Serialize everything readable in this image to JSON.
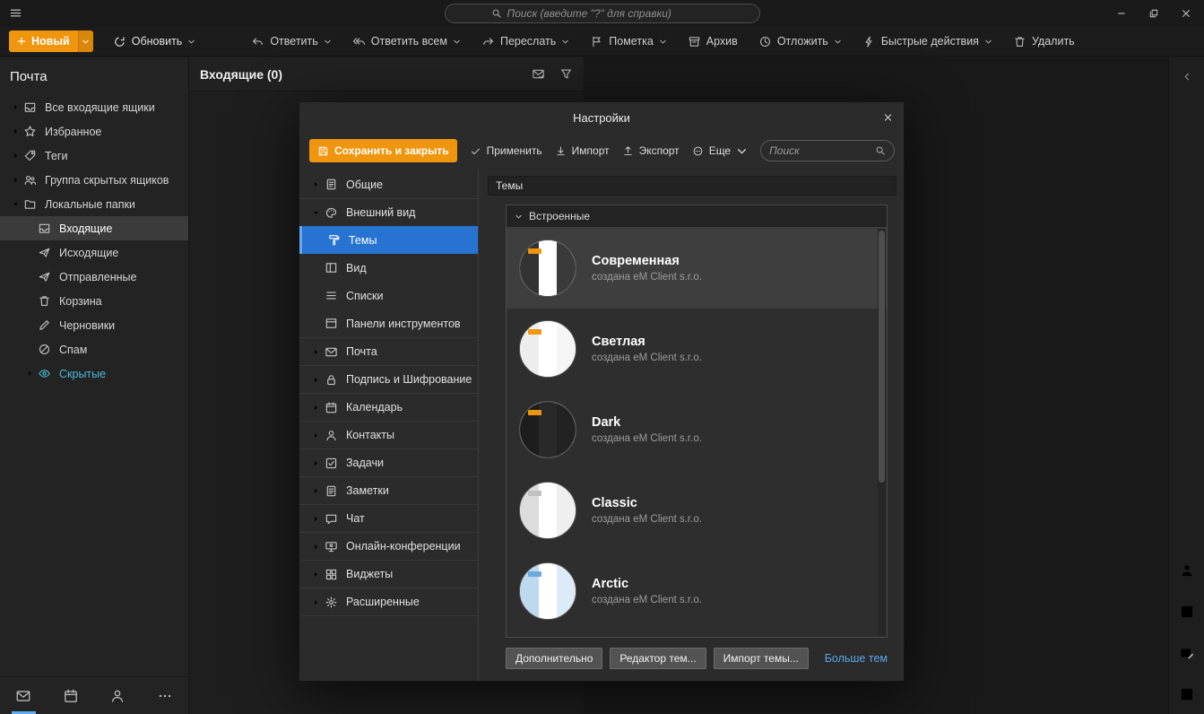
{
  "colors": {
    "accent_orange": "#f0960e",
    "selection_blue": "#2673d2",
    "link_blue": "#58a8ea",
    "hidden_teal": "#49bcd8"
  },
  "titlebar": {
    "search_placeholder": "Поиск (введите \"?\" для справки)"
  },
  "toolbar": {
    "new": {
      "label": "Новый"
    },
    "refresh": {
      "label": "Обновить"
    },
    "buttons": [
      {
        "id": "reply",
        "label": "Ответить",
        "icon": "reply-icon",
        "dropdown": true
      },
      {
        "id": "reply-all",
        "label": "Ответить всем",
        "icon": "reply-all-icon",
        "dropdown": true
      },
      {
        "id": "forward",
        "label": "Переслать",
        "icon": "forward-icon",
        "dropdown": true
      },
      {
        "id": "flag",
        "label": "Пометка",
        "icon": "flag-icon",
        "dropdown": true
      },
      {
        "id": "archive",
        "label": "Архив",
        "icon": "archive-icon",
        "dropdown": false
      },
      {
        "id": "snooze",
        "label": "Отложить",
        "icon": "snooze-icon",
        "dropdown": true
      },
      {
        "id": "quick-actions",
        "label": "Быстрые действия",
        "icon": "quick-actions-icon",
        "dropdown": true
      },
      {
        "id": "delete",
        "label": "Удалить",
        "icon": "delete-icon",
        "dropdown": false
      }
    ]
  },
  "sidebar": {
    "title": "Почта",
    "items": [
      {
        "id": "all-inboxes",
        "label": "Все входящие ящики",
        "icon": "inbox-all-icon",
        "chevron": "right",
        "level": 0
      },
      {
        "id": "favorites",
        "label": "Избранное",
        "icon": "star-icon",
        "chevron": "right",
        "level": 0
      },
      {
        "id": "tags",
        "label": "Теги",
        "icon": "tag-icon",
        "chevron": "right",
        "level": 0
      },
      {
        "id": "hidden-group",
        "label": "Группа скрытых ящиков",
        "icon": "group-icon",
        "chevron": "right",
        "level": 0
      },
      {
        "id": "local-folders",
        "label": "Локальные папки",
        "icon": "folder-icon",
        "chevron": "down",
        "level": 0
      },
      {
        "id": "inbox",
        "label": "Входящие",
        "icon": "inbox-icon",
        "chevron": "none",
        "level": 1,
        "selected": true
      },
      {
        "id": "outbox",
        "label": "Исходящие",
        "icon": "outbox-icon",
        "chevron": "none",
        "level": 1
      },
      {
        "id": "sent",
        "label": "Отправленные",
        "icon": "sent-icon",
        "chevron": "none",
        "level": 1
      },
      {
        "id": "trash",
        "label": "Корзина",
        "icon": "trash-icon",
        "chevron": "none",
        "level": 1
      },
      {
        "id": "drafts",
        "label": "Черновики",
        "icon": "drafts-icon",
        "chevron": "none",
        "level": 1
      },
      {
        "id": "spam",
        "label": "Спам",
        "icon": "spam-icon",
        "chevron": "none",
        "level": 1
      },
      {
        "id": "hidden",
        "label": "Скрытые",
        "icon": "hidden-icon",
        "chevron": "right",
        "level": 1,
        "muted": true
      }
    ],
    "bottom_tabs": [
      {
        "id": "mail",
        "icon": "mail-icon",
        "active": true
      },
      {
        "id": "calendar",
        "icon": "calendar-icon",
        "active": false
      },
      {
        "id": "contacts",
        "icon": "contacts-icon",
        "active": false
      },
      {
        "id": "more",
        "icon": "more-icon",
        "active": false
      }
    ]
  },
  "list_header": {
    "title": "Входящие (0)"
  },
  "rightbar": {
    "buttons": [
      {
        "id": "contacts-panel",
        "icon": "contacts-icon",
        "active": false
      },
      {
        "id": "agenda-panel",
        "icon": "tasks-icon",
        "active": false
      },
      {
        "id": "compose-panel",
        "icon": "compose-icon",
        "active": false
      },
      {
        "id": "widgets-panel",
        "icon": "agenda-icon",
        "active": true
      }
    ]
  },
  "dialog": {
    "title": "Настройки",
    "toolbar": {
      "save_close": "Сохранить и закрыть",
      "apply": "Применить",
      "import": "Импорт",
      "export": "Экспорт",
      "more": "Еще",
      "search_placeholder": "Поиск"
    },
    "nav": [
      {
        "id": "general",
        "label": "Общие",
        "icon": "general-icon",
        "chevron": "right",
        "level": 0
      },
      {
        "id": "appearance",
        "label": "Внешний вид",
        "icon": "appearance-icon",
        "chevron": "down",
        "level": 0
      },
      {
        "id": "themes",
        "label": "Темы",
        "icon": "themes-icon",
        "level": 1,
        "selected": true
      },
      {
        "id": "view",
        "label": "Вид",
        "icon": "view-icon",
        "level": 1
      },
      {
        "id": "lists",
        "label": "Списки",
        "icon": "lists-icon",
        "level": 1
      },
      {
        "id": "toolbars",
        "label": "Панели инструментов",
        "icon": "toolbars-icon",
        "level": 1
      },
      {
        "id": "mail",
        "label": "Почта",
        "icon": "mail-icon",
        "chevron": "right",
        "level": 0
      },
      {
        "id": "signature-encryption",
        "label": "Подпись и Шифрование",
        "icon": "signature-icon",
        "chevron": "right",
        "level": 0
      },
      {
        "id": "calendar",
        "label": "Календарь",
        "icon": "calendar-icon",
        "chevron": "right",
        "level": 0
      },
      {
        "id": "contacts",
        "label": "Контакты",
        "icon": "contacts-icon",
        "chevron": "right",
        "level": 0
      },
      {
        "id": "tasks",
        "label": "Задачи",
        "icon": "tasks-icon",
        "chevron": "right",
        "level": 0
      },
      {
        "id": "notes",
        "label": "Заметки",
        "icon": "notes-icon",
        "chevron": "right",
        "level": 0
      },
      {
        "id": "chat",
        "label": "Чат",
        "icon": "chat-icon",
        "chevron": "right",
        "level": 0
      },
      {
        "id": "conferences",
        "label": "Онлайн-конференции",
        "icon": "conference-icon",
        "chevron": "right",
        "level": 0
      },
      {
        "id": "widgets",
        "label": "Виджеты",
        "icon": "widgets-icon",
        "chevron": "right",
        "level": 0
      },
      {
        "id": "advanced",
        "label": "Расширенные",
        "icon": "advanced-icon",
        "chevron": "right",
        "level": 0
      }
    ],
    "content": {
      "section_title": "Темы",
      "group_title": "Встроенные",
      "themes": [
        {
          "name": "Современная",
          "author": "создана eM Client s.r.o.",
          "selected": true,
          "swatch": [
            "#333333",
            "#ffffff",
            "#3a3a3a"
          ],
          "accent": "#f0960e"
        },
        {
          "name": "Светлая",
          "author": "создана eM Client s.r.o.",
          "selected": false,
          "swatch": [
            "#ededed",
            "#ffffff",
            "#f5f5f5"
          ],
          "accent": "#f0960e"
        },
        {
          "name": "Dark",
          "author": "создана eM Client s.r.o.",
          "selected": false,
          "swatch": [
            "#1d1d1d",
            "#292929",
            "#222222"
          ],
          "accent": "#f0960e"
        },
        {
          "name": "Classic",
          "author": "создана eM Client s.r.o.",
          "selected": false,
          "swatch": [
            "#dcdcdc",
            "#ffffff",
            "#efefef"
          ],
          "accent": "#c0c0c0"
        },
        {
          "name": "Arctic",
          "author": "создана eM Client s.r.o.",
          "selected": false,
          "swatch": [
            "#bdd9ef",
            "#ffffff",
            "#ddeaf7"
          ],
          "accent": "#6ca9dd"
        }
      ],
      "buttons": [
        "Дополнительно",
        "Редактор тем...",
        "Импорт темы..."
      ],
      "more_link": "Больше тем"
    }
  }
}
